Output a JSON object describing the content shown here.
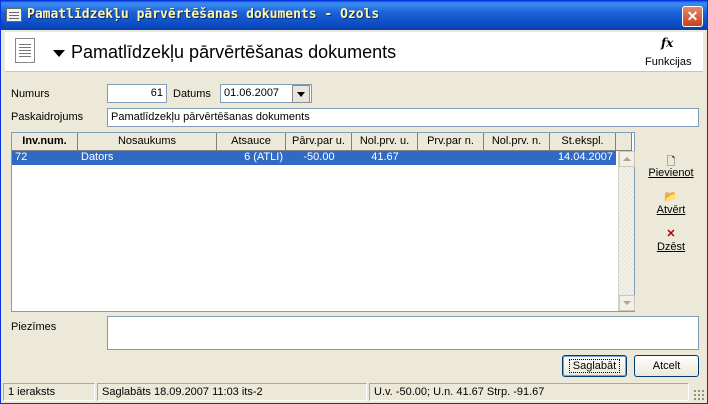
{
  "window": {
    "title": "Pamatlīdzekļu pārvērtēšanas dokuments - Ozols",
    "close_label": "✕"
  },
  "header": {
    "title": "Pamatlīdzekļu pārvērtēšanas dokuments",
    "functions_label": "Funkcijas",
    "functions_icon_text": "fx"
  },
  "form": {
    "numurs_label": "Numurs",
    "numurs_value": "61",
    "datums_label": "Datums",
    "datums_value": "01.06.2007",
    "paskaidrojums_label": "Paskaidrojums",
    "paskaidrojums_value": "Pamatlīdzekļu pārvērtēšanas dokuments",
    "piezimes_label": "Piezīmes",
    "piezimes_value": ""
  },
  "grid": {
    "columns": [
      "Inv.num.",
      "Nosaukums",
      "Atsauce",
      "Pārv.par u.",
      "Nol.prv. u.",
      "Prv.par n.",
      "Nol.prv. n.",
      "St.ekspl."
    ],
    "rows": [
      [
        "72",
        "Dators",
        "6 (ATLI)",
        "-50.00",
        "41.67",
        "",
        "",
        "14.04.2007"
      ]
    ]
  },
  "actions": {
    "add_label": "Pievienot",
    "open_label": "Atvērt",
    "delete_label": "Dzēst"
  },
  "buttons": {
    "save_label": "Saglabāt",
    "cancel_label": "Atcelt"
  },
  "status": {
    "count": "1 ieraksts",
    "saved": "Saglabāts 18.09.2007 11:03 its-2",
    "totals": "U.v. -50.00; U.n. 41.67 Strp. -91.67"
  },
  "colors": {
    "titlebar": "#0a49c0",
    "title_text": "#fff7a8",
    "selection": "#316ac5",
    "window_bg": "#ece9d8"
  }
}
